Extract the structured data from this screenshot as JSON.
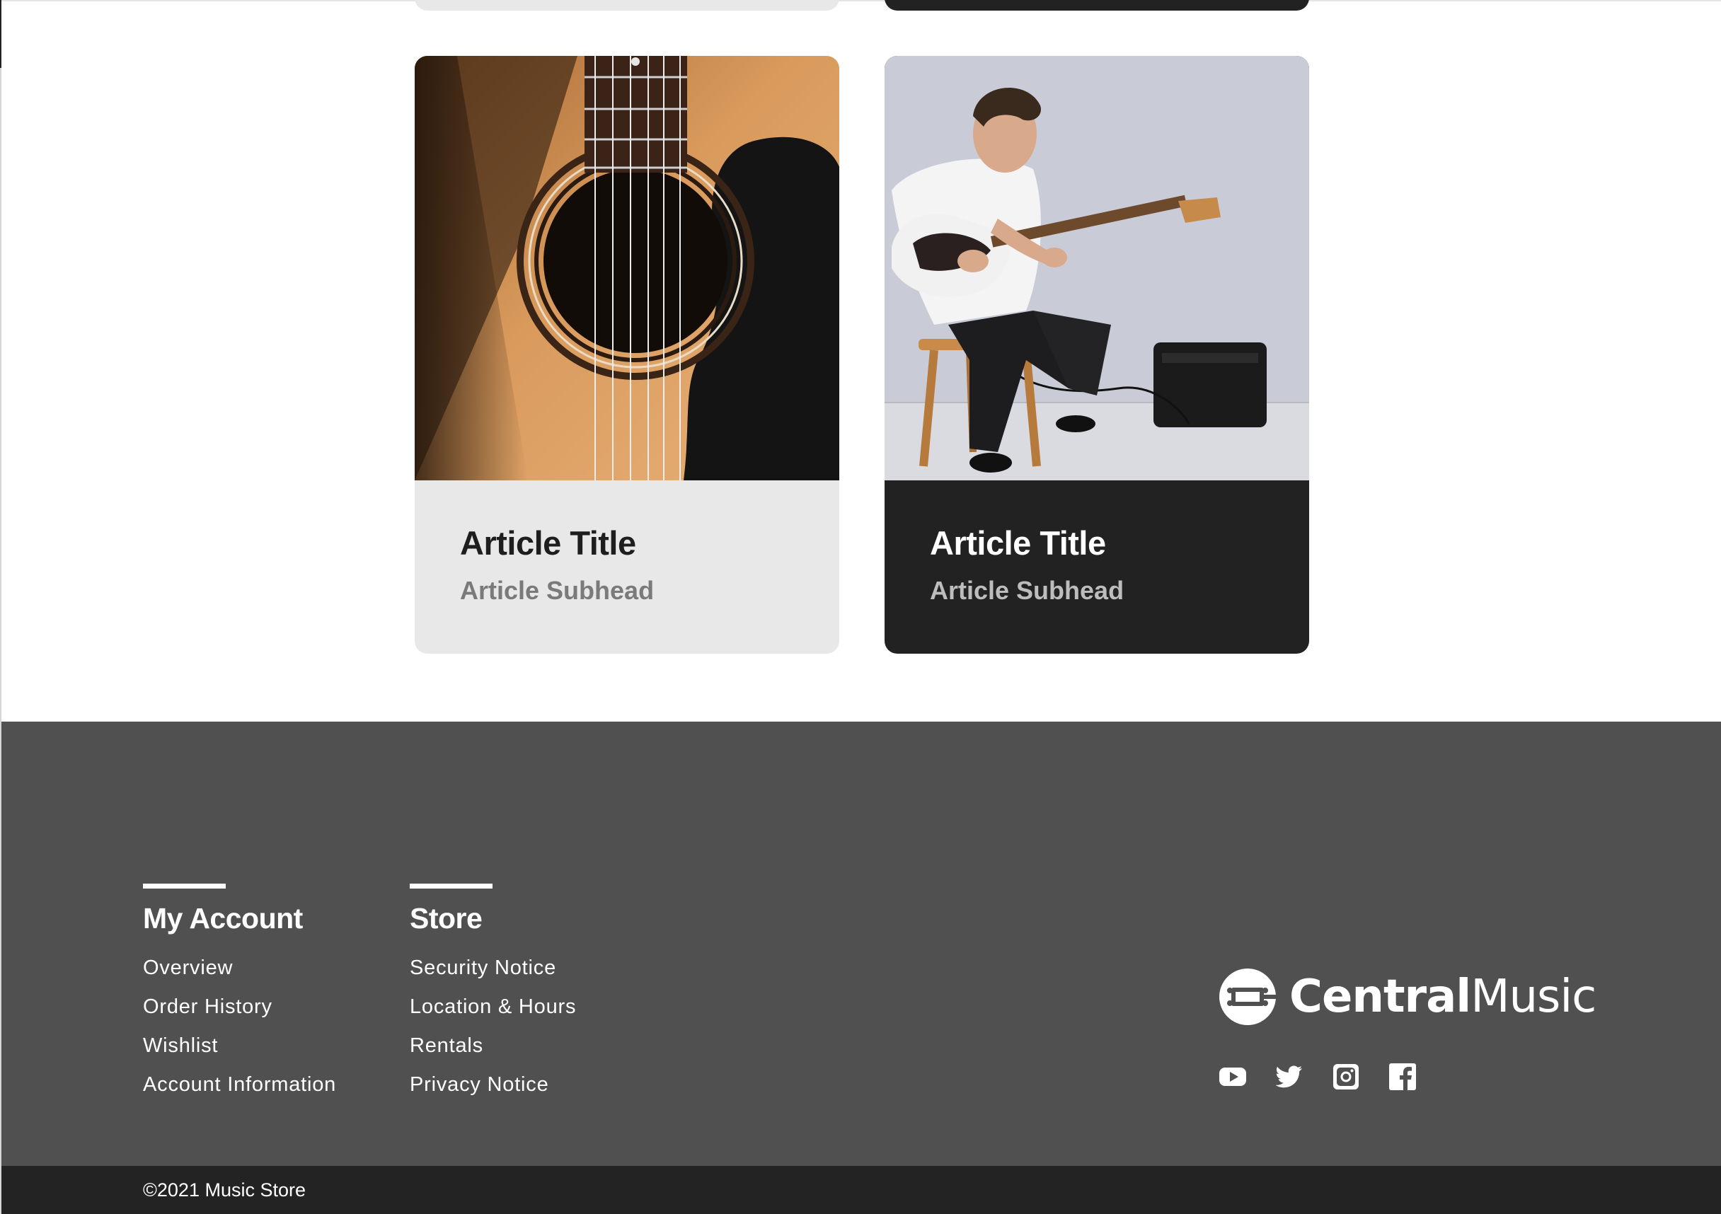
{
  "articles": [
    {
      "title": "Article Title",
      "subhead": "Article Subhead",
      "image": "acoustic-guitar-closeup-photo",
      "theme": "light"
    },
    {
      "title": "Article Title",
      "subhead": "Article Subhead",
      "image": "man-playing-electric-guitar-photo",
      "theme": "dark"
    }
  ],
  "footer": {
    "account": {
      "heading": "My Account",
      "links": [
        "Overview",
        "Order History",
        "Wishlist",
        "Account Information"
      ]
    },
    "store": {
      "heading": "Store",
      "links": [
        "Security Notice",
        "Location & Hours",
        "Rentals",
        "Privacy Notice"
      ]
    },
    "logo": {
      "bold": "Central",
      "light": "Music",
      "icon": "guitar-headstock-logo-icon"
    },
    "socials": [
      "youtube-icon",
      "twitter-icon",
      "instagram-icon",
      "facebook-icon"
    ],
    "copyright": "©2021 Music Store"
  },
  "colors": {
    "footer_bg": "#505050",
    "bottom_bar_bg": "#232323",
    "card_light_bg": "#e8e8e8",
    "card_dark_bg": "#222222"
  }
}
